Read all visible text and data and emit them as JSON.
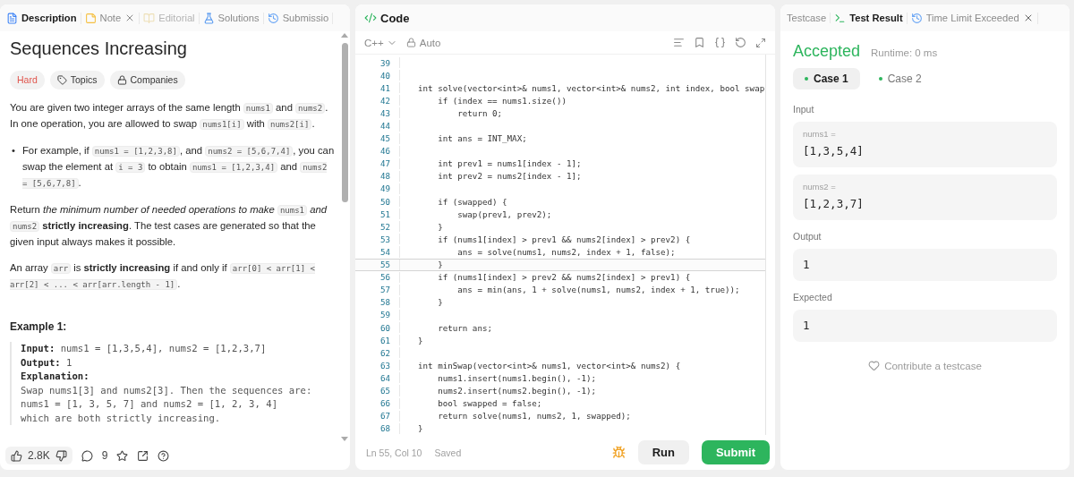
{
  "left_panel": {
    "tabs": [
      {
        "label": "Description",
        "selected": true,
        "disabled": false,
        "closable": false
      },
      {
        "label": "Note",
        "selected": false,
        "disabled": false,
        "closable": true
      },
      {
        "label": "Editorial",
        "selected": false,
        "disabled": true,
        "closable": false
      },
      {
        "label": "Solutions",
        "selected": false,
        "disabled": false,
        "closable": false
      },
      {
        "label": "Submissio",
        "selected": false,
        "disabled": false,
        "closable": false
      }
    ],
    "title": "Sequences Increasing",
    "tags": [
      {
        "kind": "difficulty",
        "label": "Hard"
      },
      {
        "kind": "topics",
        "label": "Topics"
      },
      {
        "kind": "companies",
        "label": "Companies"
      }
    ],
    "paragraphs": [
      {
        "kind": "text",
        "parts": [
          {
            "kind": "plain",
            "text": "You are given two integer arrays of the same length "
          },
          {
            "kind": "code",
            "text": "nums1"
          },
          {
            "kind": "plain",
            "text": " and "
          },
          {
            "kind": "code",
            "text": "nums2"
          },
          {
            "kind": "plain",
            "text": ". In one operation, you are allowed to swap "
          },
          {
            "kind": "code",
            "text": "nums1[i]"
          },
          {
            "kind": "plain",
            "text": " with "
          },
          {
            "kind": "code",
            "text": "nums2[i]"
          },
          {
            "kind": "plain",
            "text": "."
          }
        ]
      },
      {
        "kind": "bullet",
        "marker": "•",
        "parts": [
          {
            "kind": "plain",
            "text": "For example, if "
          },
          {
            "kind": "code",
            "text": "nums1 = [1,2,3,8]"
          },
          {
            "kind": "plain",
            "text": ", and "
          },
          {
            "kind": "code",
            "text": "nums2 = [5,6,7,4]"
          },
          {
            "kind": "plain",
            "text": ", you can swap the element at "
          },
          {
            "kind": "code",
            "text": "i = 3"
          },
          {
            "kind": "plain",
            "text": " to obtain "
          },
          {
            "kind": "code",
            "text": "nums1 = [1,2,3,4]"
          },
          {
            "kind": "plain",
            "text": " and "
          },
          {
            "kind": "code",
            "text": "nums2 = [5,6,7,8]"
          },
          {
            "kind": "plain",
            "text": "."
          }
        ]
      },
      {
        "kind": "text",
        "parts": [
          {
            "kind": "plain",
            "text": "Return *the minimum number of needed operations to make* "
          },
          {
            "kind": "code",
            "text": "nums1"
          },
          {
            "kind": "plain",
            "text": " *and* "
          },
          {
            "kind": "code",
            "text": "nums2"
          },
          {
            "kind": "plain",
            "text": " **strictly increasing**. The test cases are generated so that the given input always makes it possible."
          }
        ]
      },
      {
        "kind": "text",
        "parts": [
          {
            "kind": "plain",
            "text": "An array "
          },
          {
            "kind": "code",
            "text": "arr"
          },
          {
            "kind": "plain",
            "text": " is **strictly increasing** if and only if "
          },
          {
            "kind": "code",
            "text": "arr[0] < arr[1] < arr[2] < ... < arr[arr.length - 1]"
          },
          {
            "kind": "plain",
            "text": "."
          }
        ]
      }
    ],
    "example": {
      "title": "Example 1:",
      "lines": [
        {
          "label": "Input:",
          "text": "nums1 = [1,3,5,4], nums2 = [1,2,3,7]"
        },
        {
          "label": "Output:",
          "text": "1"
        },
        {
          "label": "Explanation:"
        },
        {
          "text": "Swap nums1[3] and nums2[3]. Then the sequences are:\nnums1 = [1, 3, 5, 7] and nums2 = [1, 2, 3, 4]\nwhich are both strictly increasing."
        }
      ]
    },
    "footer": {
      "likes": "2.8K",
      "comments": "9"
    }
  },
  "code_panel": {
    "title": "Code",
    "language": "C++",
    "mode": "Auto",
    "lines": [
      {
        "number": "39",
        "current": false
      },
      {
        "number": "40",
        "current": false
      },
      {
        "number": "41",
        "current": false,
        "text": "int solve(vector<int>& nums1, vector<int>& nums2, int index, bool swap"
      },
      {
        "number": "42",
        "current": false,
        "text": "    if (index == nums1.size())"
      },
      {
        "number": "43",
        "current": false,
        "text": "        return 0;"
      },
      {
        "number": "44",
        "current": false
      },
      {
        "number": "45",
        "current": false,
        "text": "    int ans = INT_MAX;"
      },
      {
        "number": "46",
        "current": false
      },
      {
        "number": "47",
        "current": false,
        "text": "    int prev1 = nums1[index - 1];"
      },
      {
        "number": "48",
        "current": false,
        "text": "    int prev2 = nums2[index - 1];"
      },
      {
        "number": "49",
        "current": false
      },
      {
        "number": "50",
        "current": false,
        "text": "    if (swapped) {"
      },
      {
        "number": "51",
        "current": false,
        "text": "        swap(prev1, prev2);"
      },
      {
        "number": "52",
        "current": false,
        "text": "    }"
      },
      {
        "number": "53",
        "current": false,
        "text": "    if (nums1[index] > prev1 && nums2[index] > prev2) {"
      },
      {
        "number": "54",
        "current": false,
        "text": "        ans = solve(nums1, nums2, index + 1, false);"
      },
      {
        "number": "55",
        "current": true,
        "text": "    }"
      },
      {
        "number": "56",
        "current": false,
        "text": "    if (nums1[index] > prev2 && nums2[index] > prev1) {"
      },
      {
        "number": "57",
        "current": false,
        "text": "        ans = min(ans, 1 + solve(nums1, nums2, index + 1, true));"
      },
      {
        "number": "58",
        "current": false,
        "text": "    }"
      },
      {
        "number": "59",
        "current": false
      },
      {
        "number": "60",
        "current": false,
        "text": "    return ans;"
      },
      {
        "number": "61",
        "current": false,
        "text": "}"
      },
      {
        "number": "62",
        "current": false
      },
      {
        "number": "63",
        "current": false,
        "text": "int minSwap(vector<int>& nums1, vector<int>& nums2) {"
      },
      {
        "number": "64",
        "current": false,
        "text": "    nums1.insert(nums1.begin(), -1);"
      },
      {
        "number": "65",
        "current": false,
        "text": "    nums2.insert(nums2.begin(), -1);"
      },
      {
        "number": "66",
        "current": false,
        "text": "    bool swapped = false;"
      },
      {
        "number": "67",
        "current": false,
        "text": "    return solve(nums1, nums2, 1, swapped);"
      },
      {
        "number": "68",
        "current": false,
        "text": "}"
      }
    ],
    "status": {
      "position": "Ln 55, Col 10",
      "saved": "Saved"
    },
    "buttons": [
      {
        "kind": "run",
        "label": "Run"
      },
      {
        "kind": "submit",
        "label": "Submit"
      }
    ]
  },
  "result_panel": {
    "tabs": [
      {
        "label": "Testcase",
        "selected": false,
        "closable": false
      },
      {
        "label": "Test Result",
        "selected": true,
        "closable": false
      },
      {
        "label": "Time Limit Exceeded",
        "selected": false,
        "closable": true
      }
    ],
    "verdict": "Accepted",
    "runtime": "Runtime: 0 ms",
    "cases": [
      {
        "label": "Case 1",
        "selected": true,
        "color": "#2db55d"
      },
      {
        "label": "Case 2",
        "selected": false,
        "color": "#2db55d"
      }
    ],
    "sections": [
      {
        "label": "Input",
        "boxes": [
          {
            "name": "nums1 =",
            "value": "[1,3,5,4]"
          },
          {
            "name": "nums2 =",
            "value": "[1,2,3,7]"
          }
        ]
      },
      {
        "label": "Output",
        "boxes": [
          {
            "value": "1"
          }
        ]
      },
      {
        "label": "Expected",
        "boxes": [
          {
            "value": "1"
          }
        ]
      }
    ],
    "contribute": "Contribute a testcase"
  }
}
